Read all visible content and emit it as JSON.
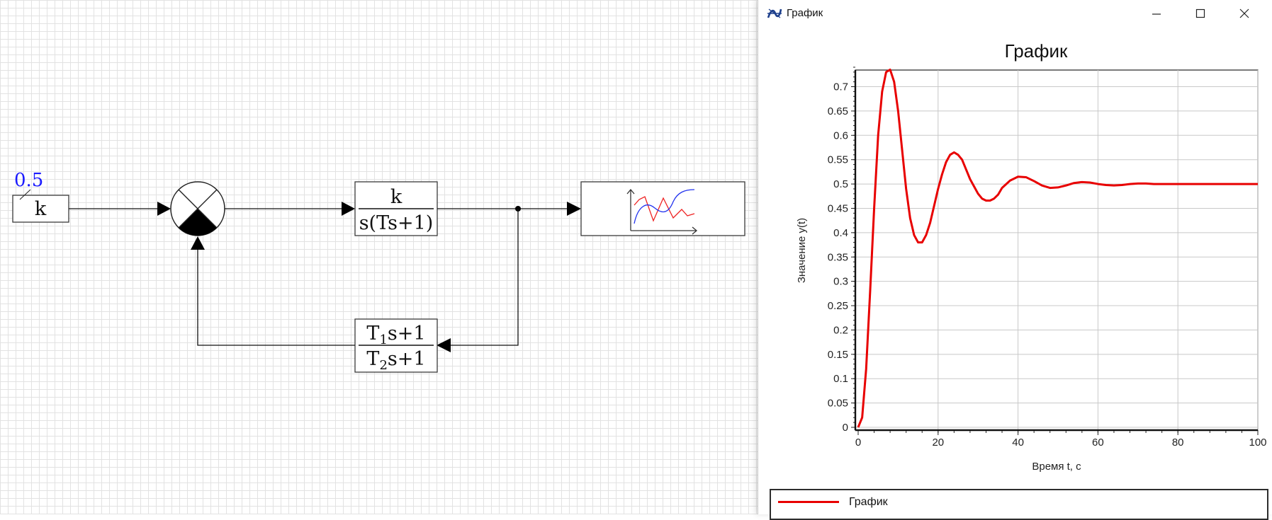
{
  "diagram": {
    "constant_value": "0.5",
    "constant_block": "k",
    "forward_block": {
      "numerator": "k",
      "denominator": "s(Ts+1)"
    },
    "feedback_block": {
      "numerator": {
        "a": "T",
        "sub": "1",
        "b": "s+1"
      },
      "denominator": {
        "a": "T",
        "sub": "2",
        "b": "s+1"
      }
    }
  },
  "window": {
    "title": "График",
    "controls": {
      "minimize": "–",
      "maximize": "☐",
      "close": "✕"
    }
  },
  "chart_data": {
    "type": "line",
    "title": "График",
    "xlabel": "Время t, c",
    "ylabel": "Значение y(t)",
    "xlim": [
      0,
      100
    ],
    "ylim": [
      0,
      0.74
    ],
    "x_ticks": [
      "0",
      "20",
      "40",
      "60",
      "80",
      "100"
    ],
    "y_ticks": [
      "0",
      "0.05",
      "0.1",
      "0.15",
      "0.2",
      "0.25",
      "0.3",
      "0.35",
      "0.4",
      "0.45",
      "0.5",
      "0.55",
      "0.6",
      "0.65",
      "0.7"
    ],
    "grid": true,
    "legend_position": "bottom",
    "series": [
      {
        "name": "График",
        "color": "#e80000",
        "x": [
          0,
          1,
          2,
          3,
          4,
          5,
          6,
          7,
          8,
          9,
          10,
          11,
          12,
          13,
          14,
          15,
          16,
          17,
          18,
          19,
          20,
          21,
          22,
          23,
          24,
          25,
          26,
          27,
          28,
          29,
          30,
          31,
          32,
          33,
          34,
          35,
          36,
          38,
          40,
          42,
          44,
          46,
          48,
          50,
          52,
          54,
          56,
          58,
          60,
          62,
          64,
          66,
          68,
          70,
          72,
          74,
          76,
          78,
          80,
          85,
          90,
          95,
          100
        ],
        "y": [
          0.0,
          0.02,
          0.12,
          0.28,
          0.45,
          0.6,
          0.69,
          0.73,
          0.735,
          0.71,
          0.65,
          0.57,
          0.49,
          0.43,
          0.395,
          0.38,
          0.38,
          0.395,
          0.42,
          0.455,
          0.49,
          0.52,
          0.545,
          0.56,
          0.565,
          0.56,
          0.55,
          0.53,
          0.51,
          0.495,
          0.48,
          0.47,
          0.466,
          0.466,
          0.47,
          0.478,
          0.492,
          0.507,
          0.515,
          0.514,
          0.506,
          0.497,
          0.492,
          0.493,
          0.497,
          0.502,
          0.504,
          0.503,
          0.5,
          0.498,
          0.497,
          0.498,
          0.5,
          0.501,
          0.501,
          0.5,
          0.5,
          0.5,
          0.5,
          0.5,
          0.5,
          0.5,
          0.5
        ]
      }
    ]
  }
}
